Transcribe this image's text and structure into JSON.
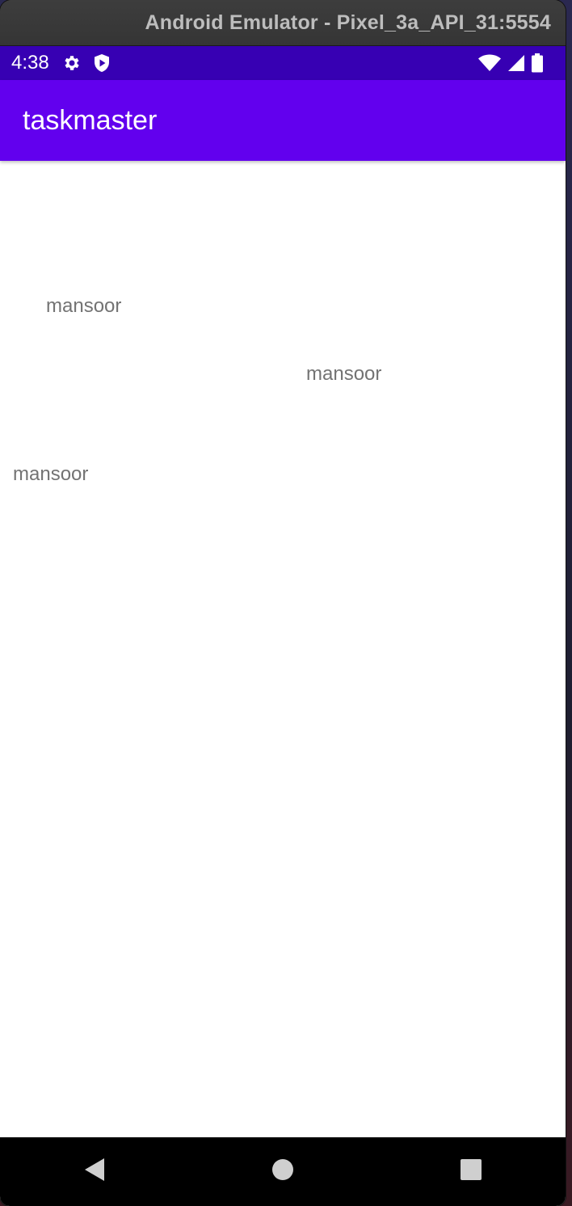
{
  "window": {
    "title": "Android Emulator - Pixel_3a_API_31:5554"
  },
  "status_bar": {
    "time": "4:38",
    "left_icons": [
      "gear-icon",
      "shield-icon"
    ],
    "right_icons": [
      "wifi-icon",
      "cell-signal-icon",
      "battery-icon"
    ],
    "color": "#3700B3"
  },
  "app_bar": {
    "title": "taskmaster",
    "color": "#6200EE"
  },
  "tasks": [
    {
      "label": "mansoor"
    },
    {
      "label": "mansoor"
    },
    {
      "label": "mansoor"
    }
  ],
  "nav_bar": {
    "buttons": [
      "back-icon",
      "home-icon",
      "recents-icon"
    ]
  }
}
